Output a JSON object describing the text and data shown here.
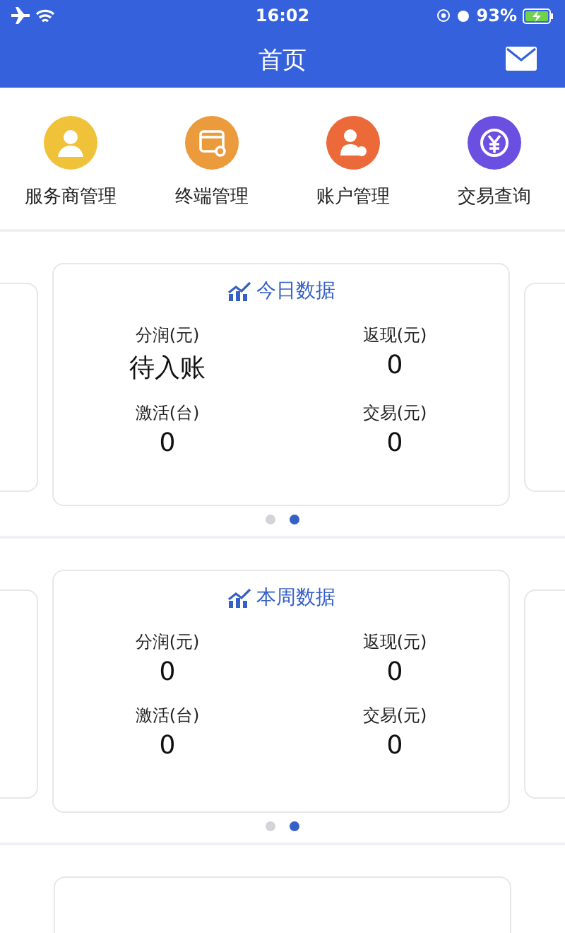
{
  "status_bar": {
    "time": "16:02",
    "battery": "93%"
  },
  "nav": {
    "title": "首页"
  },
  "shortcuts": [
    {
      "kind": "person",
      "label": "服务商管理",
      "color": "#f0c23a"
    },
    {
      "kind": "terminal",
      "label": "终端管理",
      "color": "#eb9a3c"
    },
    {
      "kind": "account",
      "label": "账户管理",
      "color": "#ec6a3a"
    },
    {
      "kind": "yuan",
      "label": "交易查询",
      "color": "#6a4fe0"
    }
  ],
  "sections": [
    {
      "title": "今日数据",
      "stats": [
        {
          "label": "分润(元)",
          "value": "待入账"
        },
        {
          "label": "返现(元)",
          "value": "0"
        },
        {
          "label": "激活(台)",
          "value": "0"
        },
        {
          "label": "交易(元)",
          "value": "0"
        }
      ],
      "dots": [
        {
          "selected": false
        },
        {
          "selected": true
        }
      ]
    },
    {
      "title": "本周数据",
      "stats": [
        {
          "label": "分润(元)",
          "value": "0"
        },
        {
          "label": "返现(元)",
          "value": "0"
        },
        {
          "label": "激活(台)",
          "value": "0"
        },
        {
          "label": "交易(元)",
          "value": "0"
        }
      ],
      "dots": [
        {
          "selected": false
        },
        {
          "selected": true
        }
      ]
    }
  ]
}
